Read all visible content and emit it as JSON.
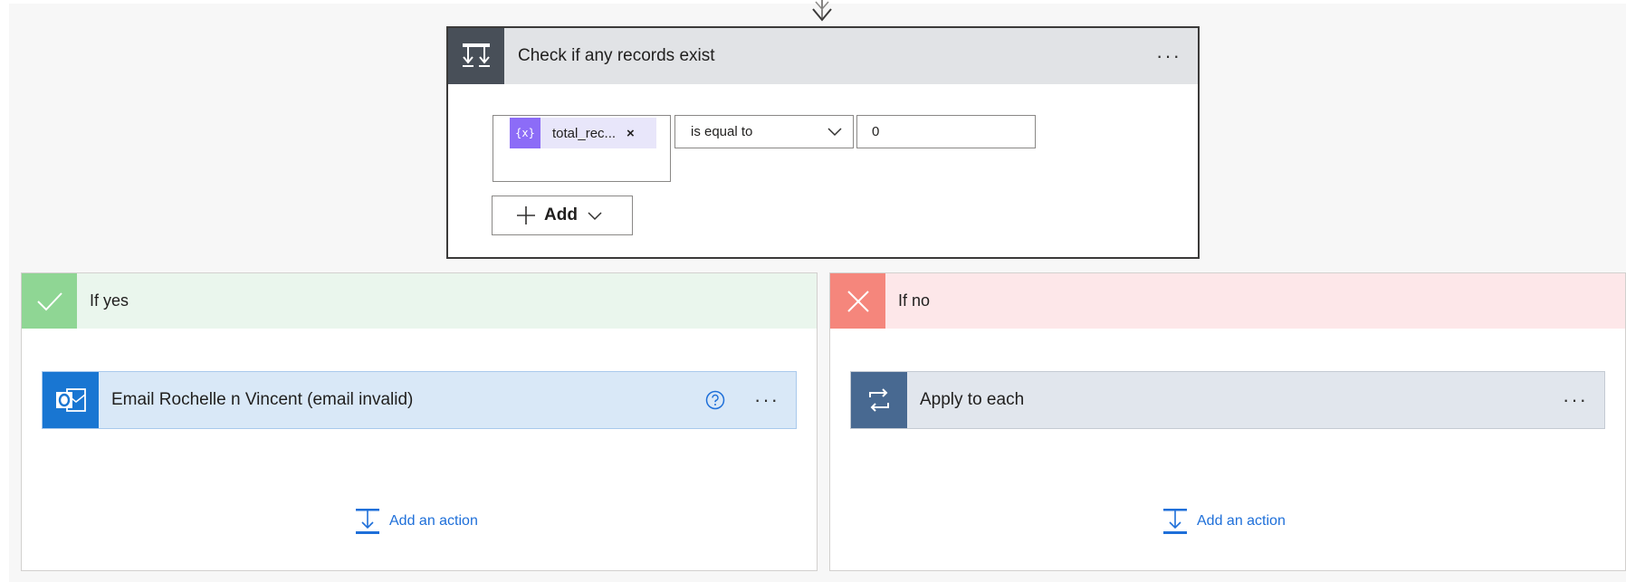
{
  "condition": {
    "title": "Check if any records exist",
    "more_label": "···",
    "token_icon_label": "{x}",
    "token_label": "total_rec...",
    "token_remove": "×",
    "operator": "is equal to",
    "value": "0",
    "add_label": "Add"
  },
  "branches": {
    "yes": {
      "title": "If yes",
      "action_title": "Email Rochelle n Vincent (email invalid)",
      "more_label": "···",
      "add_action_label": "Add an action"
    },
    "no": {
      "title": "If no",
      "action_title": "Apply to each",
      "more_label": "···",
      "add_action_label": "Add an action"
    }
  },
  "colors": {
    "accent_blue": "#1e6fd9",
    "yes_green": "#8fd694",
    "no_red": "#f5867c",
    "token_purple": "#8c6cf7",
    "outlook_blue": "#1976d2",
    "loop_blue": "#486991"
  },
  "icons": {
    "condition": "condition-icon",
    "yes": "checkmark-icon",
    "no": "close-icon",
    "outlook": "outlook-icon",
    "loop": "loop-icon",
    "add_action": "add-action-icon"
  }
}
